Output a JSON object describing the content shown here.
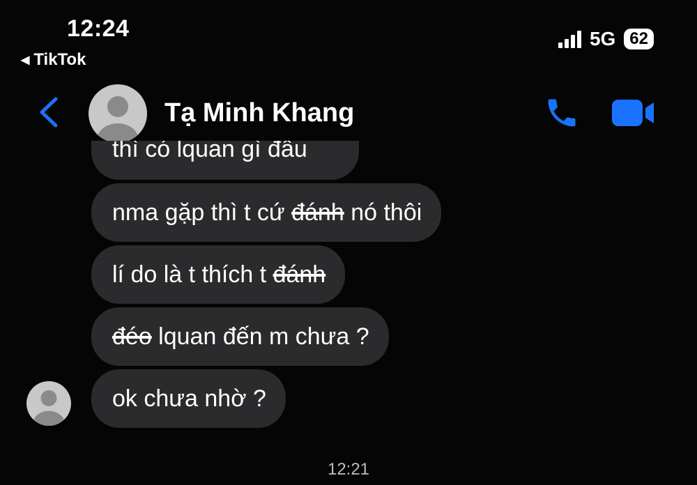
{
  "status_bar": {
    "time": "12:24",
    "back_app": "TikTok",
    "network": "5G",
    "battery": "62"
  },
  "header": {
    "contact_name": "Tạ Minh Khang"
  },
  "messages": {
    "partial_top": "thì có lquan gì đâu",
    "m1_a": "nma gặp thì t cứ ",
    "m1_strike": "đánh",
    "m1_b": " nó thôi",
    "m2_a": "lí do là t thích t ",
    "m2_strike": "đánh",
    "m3_strike": "đéo",
    "m3_b": " lquan đến m chưa ?",
    "m4": "ok chưa nhờ ?"
  },
  "timestamp": "12:21",
  "colors": {
    "accent": "#1a73ff",
    "bubble": "#2b2b2d",
    "background": "#050505"
  }
}
